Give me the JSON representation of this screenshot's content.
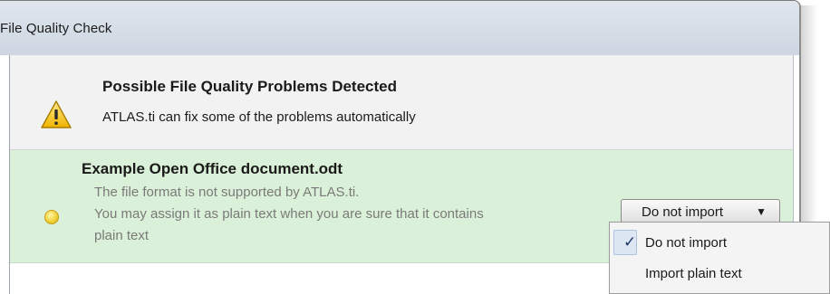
{
  "window": {
    "title": "File Quality Check"
  },
  "header": {
    "title": "Possible File Quality Problems Detected",
    "subtitle": "ATLAS.ti can fix some of the problems automatically",
    "icon": "warning-triangle-icon"
  },
  "item": {
    "file_name": "Example Open Office document.odt",
    "status_icon": "yellow-status-dot-icon",
    "message_lines": [
      "The file format is not supported by ATLAS.ti.",
      "You may assign it as plain text when you are sure that it contains",
      "plain text"
    ],
    "action": {
      "selected": "Do not import",
      "arrow": "▼"
    }
  },
  "dropdown": {
    "options": [
      {
        "label": "Do not import",
        "checked": true,
        "check_glyph": "✓"
      },
      {
        "label": "Import plain text",
        "checked": false
      }
    ]
  },
  "colors": {
    "item_background": "#dbf0d8",
    "header_background": "#f2f2f2",
    "titlebar": "#d6dee8"
  }
}
